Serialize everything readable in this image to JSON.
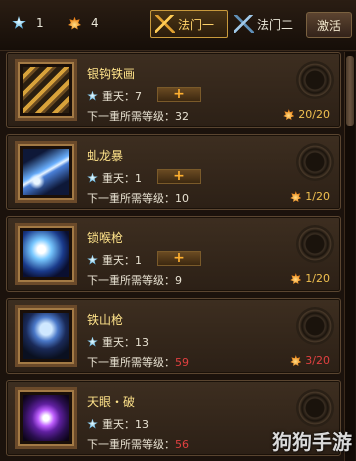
{
  "header": {
    "star_count": "1",
    "flame_count": "4",
    "tabs": [
      {
        "label": "法门一",
        "active": true
      },
      {
        "label": "法门二",
        "active": false
      }
    ],
    "activate_label": "激活"
  },
  "skills": [
    {
      "name": "银钩铁画",
      "level": "重天：7",
      "req_label": "下一重所需等级：",
      "req_value": "32",
      "req_color": "normal",
      "cost": "20/20",
      "cost_color": "normal",
      "has_plus": true
    },
    {
      "name": "虬龙暴",
      "level": "重天：1",
      "req_label": "下一重所需等级：",
      "req_value": "10",
      "req_color": "normal",
      "cost": "1/20",
      "cost_color": "normal",
      "has_plus": true
    },
    {
      "name": "锁喉枪",
      "level": "重天：1",
      "req_label": "下一重所需等级：",
      "req_value": "9",
      "req_color": "normal",
      "cost": "1/20",
      "cost_color": "normal",
      "has_plus": true
    },
    {
      "name": "铁山枪",
      "level": "重天：13",
      "req_label": "下一重所需等级：",
      "req_value": "59",
      "req_color": "red",
      "cost": "3/20",
      "cost_color": "red",
      "has_plus": false
    },
    {
      "name": "天眼・破",
      "level": "重天：13",
      "req_label": "下一重所需等级：",
      "req_value": "56",
      "req_color": "red",
      "cost": "",
      "cost_color": "normal",
      "has_plus": false
    }
  ],
  "watermark": "狗狗手游",
  "colors": {
    "accent": "#ffd36a",
    "name": "#ffe38a",
    "red": "#e04040",
    "cost": "#f0c050"
  }
}
